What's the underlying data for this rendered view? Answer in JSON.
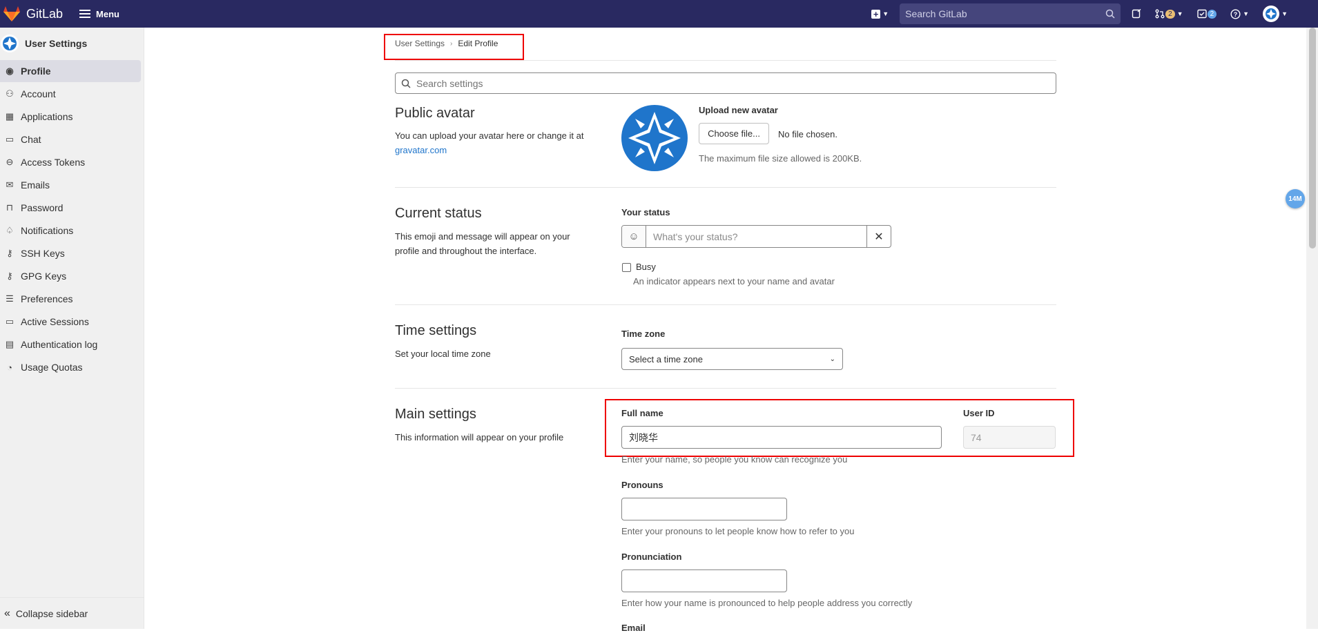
{
  "navbar": {
    "brand": "GitLab",
    "menu_label": "Menu",
    "search_placeholder": "Search GitLab",
    "merge_requests_count": "2",
    "todos_count": "2",
    "colors": {
      "bg": "#292961",
      "logo": "#e24329"
    }
  },
  "sidebar": {
    "title": "User Settings",
    "items": [
      {
        "label": "Profile",
        "icon": "profile-icon",
        "active": true
      },
      {
        "label": "Account",
        "icon": "account-icon"
      },
      {
        "label": "Applications",
        "icon": "applications-icon"
      },
      {
        "label": "Chat",
        "icon": "chat-icon"
      },
      {
        "label": "Access Tokens",
        "icon": "token-icon"
      },
      {
        "label": "Emails",
        "icon": "mail-icon"
      },
      {
        "label": "Password",
        "icon": "lock-icon"
      },
      {
        "label": "Notifications",
        "icon": "bell-icon"
      },
      {
        "label": "SSH Keys",
        "icon": "key-icon"
      },
      {
        "label": "GPG Keys",
        "icon": "key-icon"
      },
      {
        "label": "Preferences",
        "icon": "preferences-icon"
      },
      {
        "label": "Active Sessions",
        "icon": "monitor-icon"
      },
      {
        "label": "Authentication log",
        "icon": "log-icon"
      },
      {
        "label": "Usage Quotas",
        "icon": "quota-icon"
      }
    ],
    "collapse_label": "Collapse sidebar"
  },
  "breadcrumb": {
    "parent": "User Settings",
    "current": "Edit Profile"
  },
  "search_settings": {
    "placeholder": "Search settings"
  },
  "avatar_section": {
    "title": "Public avatar",
    "desc": "You can upload your avatar here or change it at",
    "link": "gravatar.com",
    "upload_label": "Upload new avatar",
    "choose_button": "Choose file...",
    "no_file": "No file chosen.",
    "max_size_note": "The maximum file size allowed is 200KB."
  },
  "status_section": {
    "title": "Current status",
    "desc": "This emoji and message will appear on your profile and throughout the interface.",
    "label": "Your status",
    "placeholder": "What's your status?",
    "busy_label": "Busy",
    "busy_help": "An indicator appears next to your name and avatar"
  },
  "time_section": {
    "title": "Time settings",
    "desc": "Set your local time zone",
    "label": "Time zone",
    "select_value": "Select a time zone"
  },
  "main_section": {
    "title": "Main settings",
    "desc": "This information will appear on your profile",
    "full_name_label": "Full name",
    "full_name_value": "刘晓华",
    "full_name_help": "Enter your name, so people you know can recognize you",
    "user_id_label": "User ID",
    "user_id_value": "74",
    "pronouns_label": "Pronouns",
    "pronouns_help": "Enter your pronouns to let people know how to refer to you",
    "pronunciation_label": "Pronunciation",
    "pronunciation_help": "Enter how your name is pronounced to help people address you correctly",
    "email_label": "Email"
  },
  "perf_badge": "14M"
}
